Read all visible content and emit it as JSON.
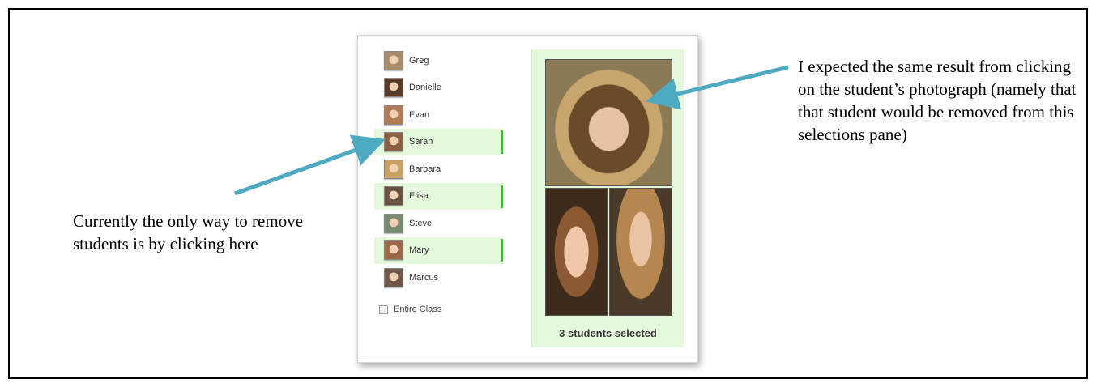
{
  "annotations": {
    "left_note": "Currently the only way to remove students is by clicking here",
    "right_note": "I expected the same result from clicking on the student’s photograph (namely that that student would be removed from this selections pane)"
  },
  "students": [
    {
      "name": "Greg",
      "selected": false,
      "avatar_color": "#a88c6a"
    },
    {
      "name": "Danielle",
      "selected": false,
      "avatar_color": "#5a3a26"
    },
    {
      "name": "Evan",
      "selected": false,
      "avatar_color": "#b07a55"
    },
    {
      "name": "Sarah",
      "selected": true,
      "avatar_color": "#8a6040"
    },
    {
      "name": "Barbara",
      "selected": false,
      "avatar_color": "#c8a060"
    },
    {
      "name": "Elisa",
      "selected": true,
      "avatar_color": "#6a5040"
    },
    {
      "name": "Steve",
      "selected": false,
      "avatar_color": "#7a8a70"
    },
    {
      "name": "Mary",
      "selected": true,
      "avatar_color": "#9a6a48"
    },
    {
      "name": "Marcus",
      "selected": false,
      "avatar_color": "#705848"
    }
  ],
  "entire_class": {
    "label": "Entire Class",
    "checked": false
  },
  "selection_pane": {
    "count_text": "3 students selected"
  },
  "colors": {
    "selected_bg": "#e4f8dc",
    "selected_bar": "#4db33d",
    "arrow": "#4eaac0"
  }
}
